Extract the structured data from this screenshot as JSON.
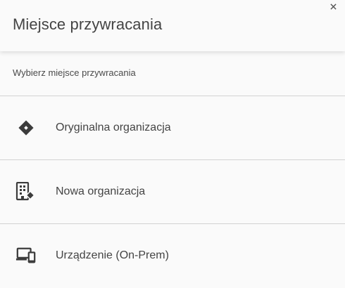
{
  "dialog": {
    "title": "Miejsce przywracania",
    "close_icon": "close-icon",
    "subtitle": "Wybierz miejsce przywracania",
    "options": [
      {
        "label": "Oryginalna organizacja",
        "icon": "diamond-icon"
      },
      {
        "label": "Nowa organizacja",
        "icon": "building-icon"
      },
      {
        "label": "Urządzenie (On-Prem)",
        "icon": "devices-icon"
      }
    ]
  },
  "colors": {
    "background": "#fafafa",
    "divider": "#d2d2d2",
    "text": "#444444",
    "icon": "#3c3c3c"
  }
}
